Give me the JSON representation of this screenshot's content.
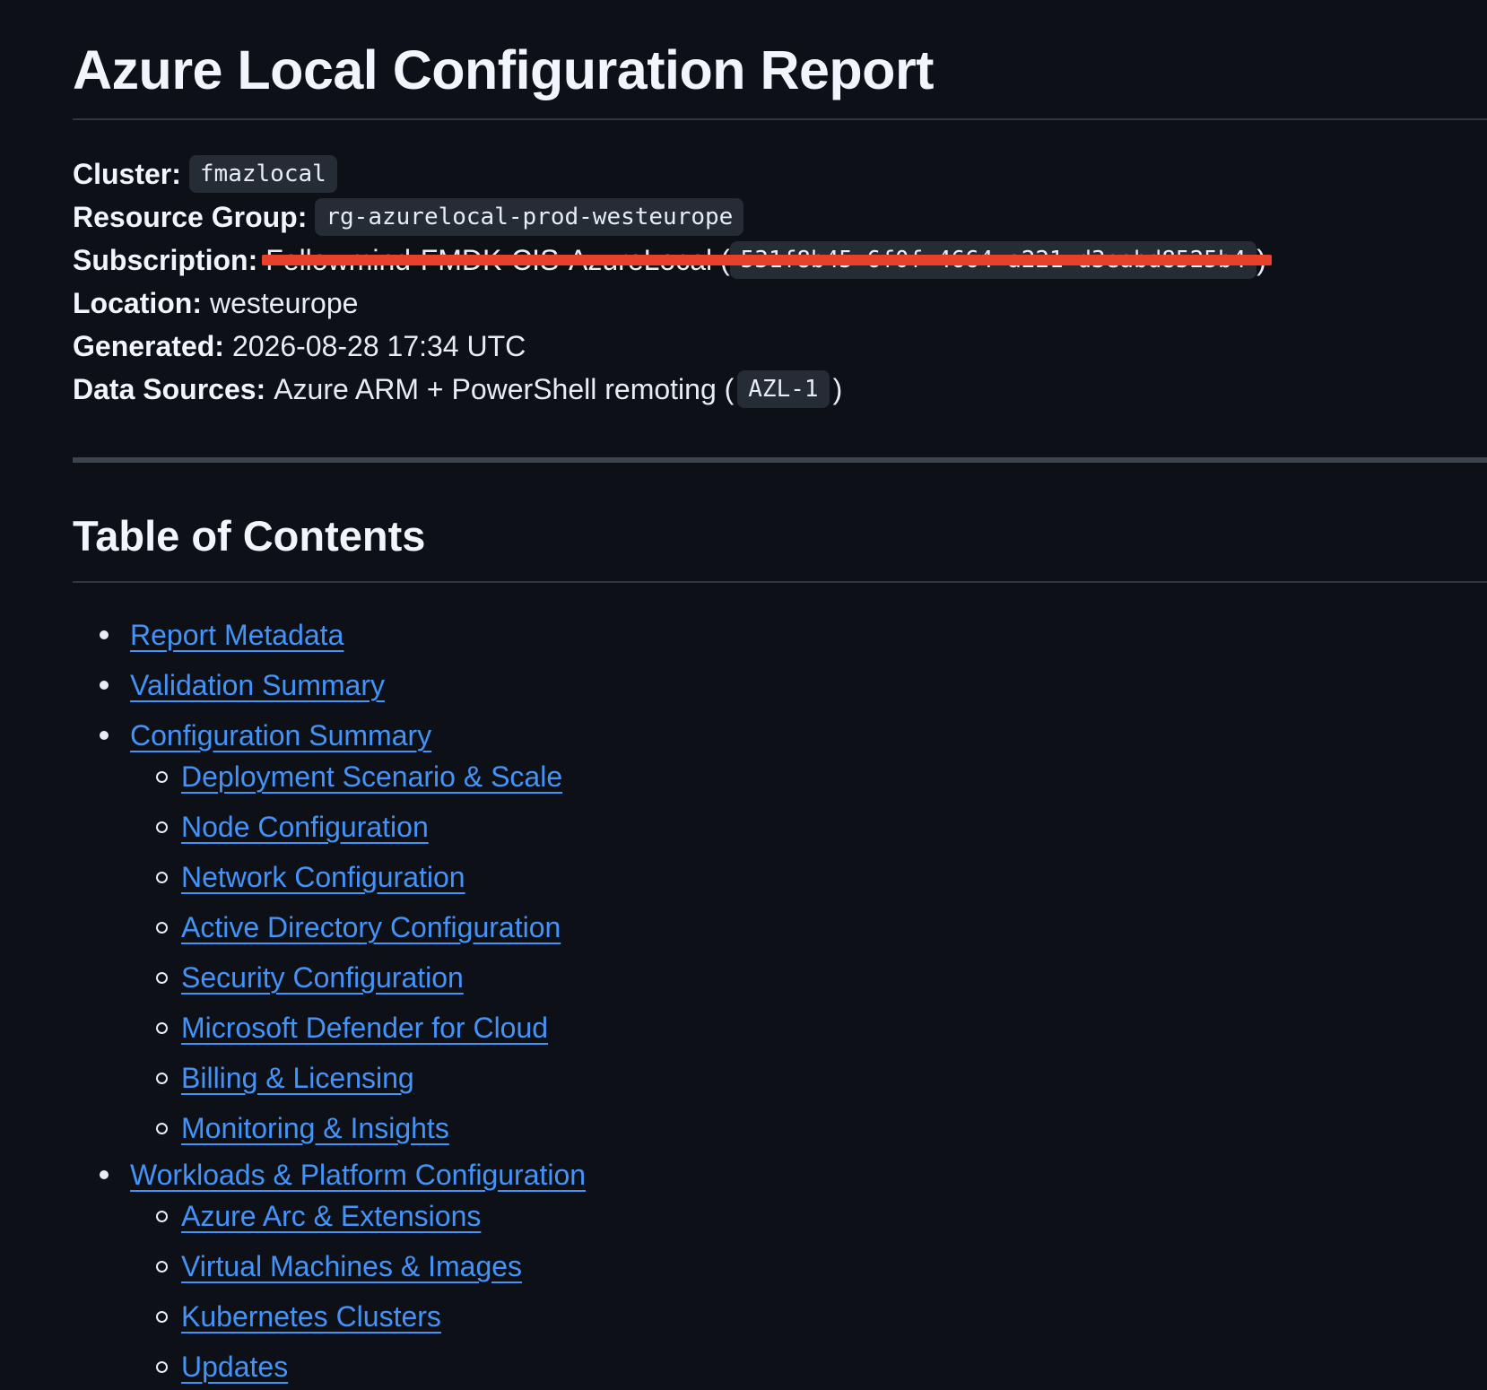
{
  "report": {
    "title": "Azure Local Configuration Report"
  },
  "meta": {
    "cluster_label": "Cluster:",
    "cluster_value": "fmazlocal",
    "resource_group_label": "Resource Group:",
    "resource_group_value": "rg-azurelocal-prod-westeurope",
    "subscription_label": "Subscription:",
    "subscription_name_redacted": "Fellowmind-FMDK-CIS-AzureLocal",
    "subscription_id_redacted": "531f8b45-6f0f-4664-a221-d3eabd8525b4",
    "location_label": "Location:",
    "location_value": "westeurope",
    "generated_label": "Generated:",
    "generated_value": "2026-08-28 17:34 UTC",
    "data_sources_label": "Data Sources:",
    "data_sources_value": "Azure ARM + PowerShell remoting (",
    "data_sources_code": "AZL-1",
    "data_sources_close": ")"
  },
  "toc": {
    "heading": "Table of Contents",
    "items": [
      {
        "label": "Report Metadata"
      },
      {
        "label": "Validation Summary"
      },
      {
        "label": "Configuration Summary",
        "children": [
          {
            "label": "Deployment Scenario & Scale"
          },
          {
            "label": "Node Configuration"
          },
          {
            "label": "Network Configuration"
          },
          {
            "label": "Active Directory Configuration"
          },
          {
            "label": "Security Configuration"
          },
          {
            "label": "Microsoft Defender for Cloud"
          },
          {
            "label": "Billing & Licensing"
          },
          {
            "label": "Monitoring & Insights"
          }
        ]
      },
      {
        "label": "Workloads & Platform Configuration",
        "children": [
          {
            "label": "Azure Arc & Extensions"
          },
          {
            "label": "Virtual Machines & Images"
          },
          {
            "label": "Kubernetes Clusters"
          },
          {
            "label": "Updates"
          }
        ]
      }
    ]
  },
  "colors": {
    "background": "#0d1117",
    "text": "#e6edf3",
    "link": "#4493f8",
    "code_bg": "#262c36",
    "redaction": "#e8402a"
  }
}
